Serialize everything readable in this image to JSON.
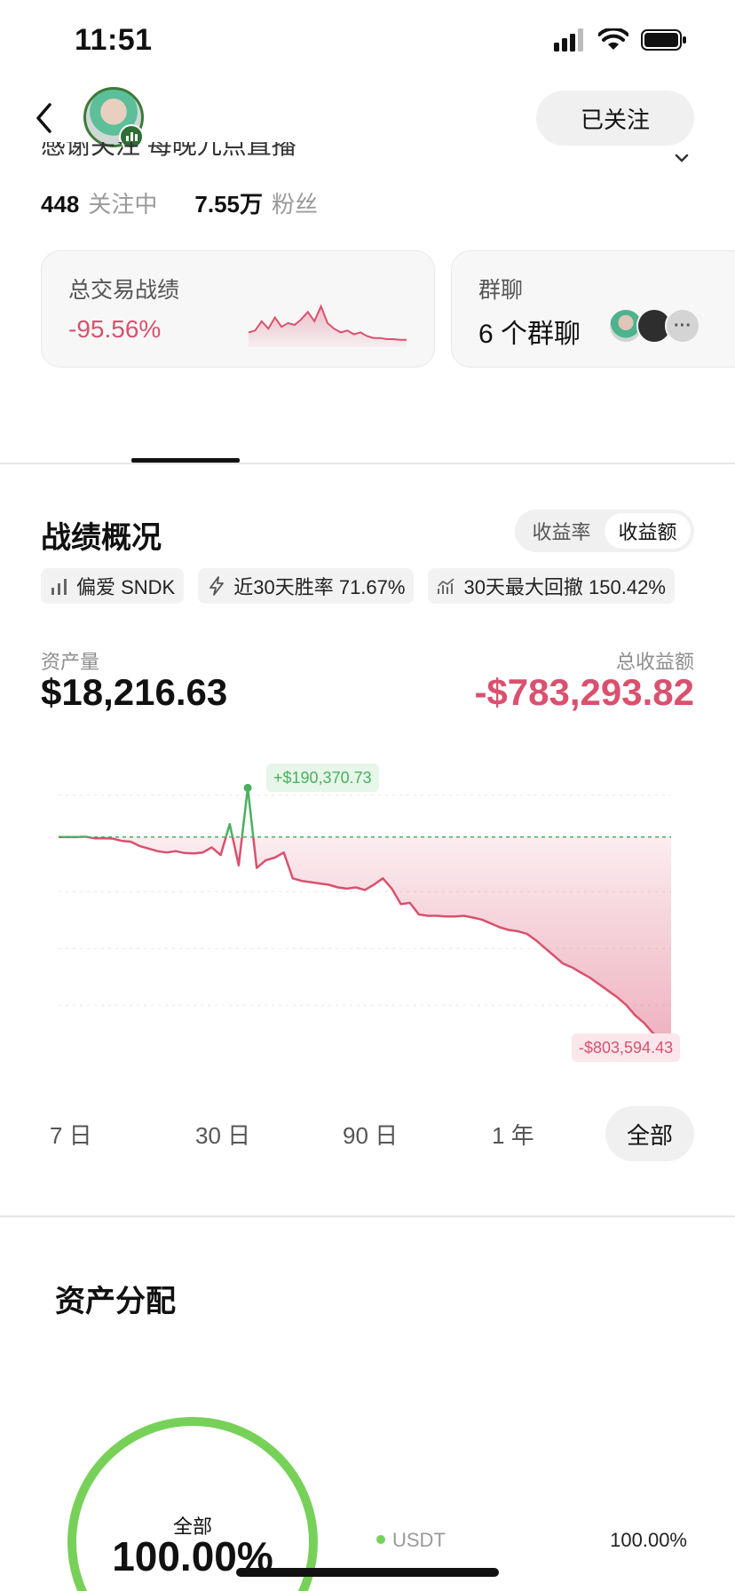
{
  "status_bar": {
    "time": "11:51"
  },
  "header": {
    "follow_label": "已关注",
    "bio": "感谢关注 每晚九点直播"
  },
  "stats": {
    "following_count": "448",
    "following_label": "关注中",
    "followers_count": "7.55万",
    "followers_label": "粉丝"
  },
  "cards": {
    "trade": {
      "title": "总交易战绩",
      "value": "-95.56%"
    },
    "group": {
      "title": "群聊",
      "count_label": "6 个群聊"
    }
  },
  "performance": {
    "title": "战绩概况",
    "segments": [
      {
        "label": "收益率",
        "active": false
      },
      {
        "label": "收益额",
        "active": true
      }
    ],
    "tags": [
      {
        "icon": "bar-chart-icon",
        "text": "偏爱 SNDK"
      },
      {
        "icon": "lightning-icon",
        "text": "近30天胜率 71.67%"
      },
      {
        "icon": "drawdown-icon",
        "text": "30天最大回撤 150.42%"
      }
    ],
    "asset_label": "资产量",
    "asset_value": "$18,216.63",
    "pnl_label": "总收益额",
    "pnl_value": "-$783,293.82",
    "max_label": "+$190,370.73",
    "min_label": "-$803,594.43",
    "ranges": [
      {
        "label": "7 日",
        "active": false
      },
      {
        "label": "30 日",
        "active": false
      },
      {
        "label": "90 日",
        "active": false
      },
      {
        "label": "1 年",
        "active": false
      },
      {
        "label": "全部",
        "active": true
      }
    ]
  },
  "allocation": {
    "title": "资产分配",
    "center_label": "全部",
    "center_pct": "100.00%",
    "items": [
      {
        "name": "USDT",
        "pct": "100.00%"
      }
    ]
  },
  "colors": {
    "negative": "#d9516e",
    "positive": "#4ab060",
    "donut": "#77d159"
  },
  "chart_data": {
    "type": "line",
    "ylim": [
      -850000,
      250000
    ],
    "baseline": 0,
    "values": [
      0,
      0,
      0,
      1000,
      -5000,
      -5000,
      -6000,
      -15000,
      -18000,
      -35000,
      -45000,
      -55000,
      -60000,
      -55000,
      -62000,
      -64000,
      -60000,
      -40000,
      -70000,
      50000,
      -110000,
      190370.73,
      -120000,
      -90000,
      -80000,
      -60000,
      -160000,
      -170000,
      -175000,
      -180000,
      -185000,
      -195000,
      -200000,
      -195000,
      -205000,
      -185000,
      -160000,
      -200000,
      -260000,
      -255000,
      -300000,
      -305000,
      -305000,
      -308000,
      -308000,
      -305000,
      -312000,
      -320000,
      -335000,
      -350000,
      -360000,
      -365000,
      -375000,
      -400000,
      -430000,
      -460000,
      -490000,
      -505000,
      -525000,
      -545000,
      -570000,
      -595000,
      -620000,
      -650000,
      -690000,
      -720000,
      -760000,
      -785000,
      -803594.43
    ],
    "max": {
      "index": 21,
      "value": 190370.73
    },
    "min": {
      "index": 68,
      "value": -803594.43
    }
  },
  "trade_spark": {
    "values": [
      0.3,
      0.35,
      0.6,
      0.4,
      0.7,
      0.45,
      0.55,
      0.5,
      0.65,
      0.85,
      0.6,
      1.0,
      0.55,
      0.4,
      0.3,
      0.35,
      0.25,
      0.3,
      0.2,
      0.15,
      0.15,
      0.12,
      0.12,
      0.1,
      0.1
    ]
  }
}
